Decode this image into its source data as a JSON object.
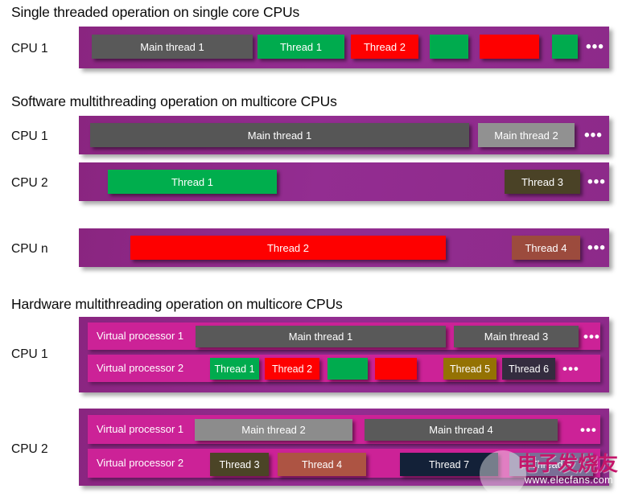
{
  "sections": [
    {
      "id": "single-threaded",
      "title": "Single threaded operation on single core CPUs",
      "rows": [
        {
          "cpu_label": "CPU 1",
          "blocks": [
            {
              "label": "Main thread 1",
              "color": "#595959"
            },
            {
              "label": "Thread 1",
              "color": "#00ab4e"
            },
            {
              "label": "Thread 2",
              "color": "#fe0000"
            },
            {
              "label": "",
              "color": "#00ab4e"
            },
            {
              "label": "",
              "color": "#fe0000"
            },
            {
              "label": "",
              "color": "#00ab4e"
            }
          ],
          "ellipsis": "•••"
        }
      ]
    },
    {
      "id": "software-multithreading",
      "title": "Software multithreading operation on multicore CPUs",
      "rows": [
        {
          "cpu_label": "CPU 1",
          "blocks": [
            {
              "label": "Main thread 1",
              "color": "#565656"
            },
            {
              "label": "Main thread 2",
              "color": "#919191"
            }
          ],
          "ellipsis": "•••"
        },
        {
          "cpu_label": "CPU 2",
          "blocks": [
            {
              "label": "Thread 1",
              "color": "#00ae4d"
            },
            {
              "label": "Thread 3",
              "color": "#4a4226"
            }
          ],
          "ellipsis": "•••"
        },
        {
          "cpu_label": "CPU n",
          "blocks": [
            {
              "label": "Thread 2",
              "color": "#fe0000"
            },
            {
              "label": "Thread 4",
              "color": "#9c4b3d"
            }
          ],
          "ellipsis": "•••"
        }
      ]
    },
    {
      "id": "hardware-multithreading",
      "title": "Hardware multithreading operation on multicore CPUs",
      "rows": [
        {
          "cpu_label": "CPU 1",
          "virtual_processors": [
            {
              "name": "Virtual processor 1",
              "blocks": [
                {
                  "label": "Main thread 1",
                  "color": "#595959"
                },
                {
                  "label": "Main thread 3",
                  "color": "#595959"
                }
              ],
              "ellipsis": "•••"
            },
            {
              "name": "Virtual processor 2",
              "blocks": [
                {
                  "label": "Thread 1",
                  "color": "#00ab4e"
                },
                {
                  "label": "Thread 2",
                  "color": "#fe0000"
                },
                {
                  "label": "",
                  "color": "#00ab4e"
                },
                {
                  "label": "",
                  "color": "#fe0000"
                },
                {
                  "label": "Thread 5",
                  "color": "#947203"
                },
                {
                  "label": "Thread 6",
                  "color": "#342c3f"
                }
              ],
              "ellipsis": "•••"
            }
          ]
        },
        {
          "cpu_label": "CPU 2",
          "virtual_processors": [
            {
              "name": "Virtual processor 1",
              "blocks": [
                {
                  "label": "Main thread 2",
                  "color": "#8c8c8c"
                },
                {
                  "label": "Main thread 4",
                  "color": "#5a5a5a"
                }
              ],
              "ellipsis": "•••"
            },
            {
              "name": "Virtual processor 2",
              "blocks": [
                {
                  "label": "Thread 3",
                  "color": "#4b4426"
                },
                {
                  "label": "Thread 4",
                  "color": "#ad5443"
                },
                {
                  "label": "Thread 7",
                  "color": "#132138"
                },
                {
                  "label": "Thread 8",
                  "color": "#7a6e96"
                }
              ],
              "ellipsis": ""
            }
          ]
        }
      ]
    }
  ],
  "watermark": {
    "chinese": "电子发烧友",
    "url": "www.elecfans.com"
  },
  "colors": {
    "band_purple": "#8e2a8b",
    "vp_magenta": "#cc2297",
    "background": "#ffffff",
    "title_text": "#0a0a0a"
  }
}
